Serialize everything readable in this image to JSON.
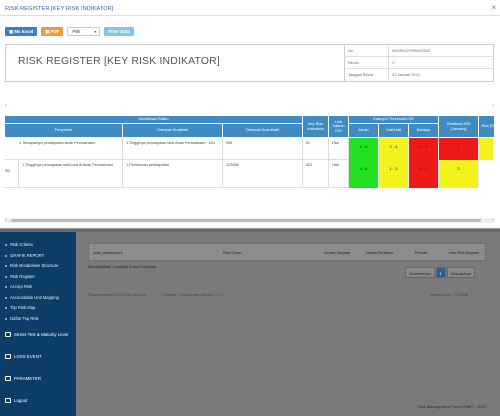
{
  "modal": {
    "title": "RISK REGISTER [KEY RISK INDIKATOR]",
    "close_glyph": "×",
    "toolbar": {
      "excel_label": "Ms Excel",
      "pdf_label": "PDF",
      "select_value": "Pilih",
      "filter_label": "Filter Data"
    },
    "doc": {
      "title": "RISK REGISTER [KEY RISK INDIKATOR]",
      "meta": [
        {
          "k": "No",
          "v": "004/RM-FORM/I/2022"
        },
        {
          "k": "Revisi",
          "v": "1"
        },
        {
          "k": "Tanggal Revisi",
          "v": "31 Januari 2022"
        }
      ]
    },
    "table": {
      "group_identifikasi": "Identifikasi Risiko",
      "col_penyebab": "Penyebab",
      "col_dampak_kualitatif": "Dampak Kualitatif",
      "col_dampak_kuantitatif": "Dampak Kuantitatif",
      "col_kri": "Key Risk Indicators",
      "col_unit": "Unit Satuan KRI",
      "group_threshold": "Kategori Threshold KRI",
      "col_aman": "Aman",
      "col_hati": "Hati-Hati",
      "col_bahaya": "Bahaya",
      "col_realisasi": "Realisasi KRI [January]",
      "col_extra": "Rea [Fe",
      "rows": [
        {
          "no": "",
          "penyebab": "1.Tercapainya pendapatan Anak Perusahaan",
          "dampak_kualitatif": "1.Tingginya pencapaian laba Anak Perusahaan : 524",
          "dampak_kuantitatif": "996",
          "kri": "KI",
          "unit": "Hari",
          "aman": "6 - 6",
          "hati": "2 - 4",
          "bahaya": "0 - 2",
          "realisasi": "1"
        },
        {
          "no": "SD",
          "penyebab": "1.Tingginya pencapaian total pad di Anak Perusahaan",
          "dampak_kualitatif": "1.Penurunan pendapatan",
          "dampak_kuantitatif": "123456",
          "kri": "321",
          "unit": "Hari",
          "aman": "4 - 6",
          "hati": "1 - 3",
          "bahaya": "0 - 1",
          "realisasi": "3"
        }
      ]
    }
  },
  "colors": {
    "header_blue": "#3f8cc4",
    "aman": "#22e022",
    "hati": "#f2f21c",
    "bahaya": "#ee1a1a",
    "sidebar": "#0b3d66"
  },
  "background": {
    "sidebar_items": [
      "Risk Criteria",
      "GRAFIK REPORT",
      "Risk Breakdown Structure",
      "Risk Register",
      "Accept Risk",
      "Accountable Unit Mapping",
      "Top Risk Map",
      "Daftar Top Risk",
      "Stress Test & Maturity Level",
      "LOSS EVENT",
      "PARAMETER",
      "Logout"
    ],
    "table_headers": [
      "judul_assessment",
      "Risk Owner",
      "Jumlah Sasaran",
      "Jumlah Peristiwa",
      "Periode",
      "View Risk Register"
    ],
    "info": "Menampilkan 1 sampai 0 dari 0 records",
    "pager": {
      "prev": "Sebelumnya",
      "page": "1",
      "next": "Selanjutnya"
    },
    "footer_left": "Page rendered in 0.0158 seconds",
    "footer_mid": "Engine : CodeIgniter Version 3.1.8",
    "footer_right": "Memory use : 0.95MB",
    "bottom_right": "Risk Management Forum (RMF) - 2022"
  }
}
